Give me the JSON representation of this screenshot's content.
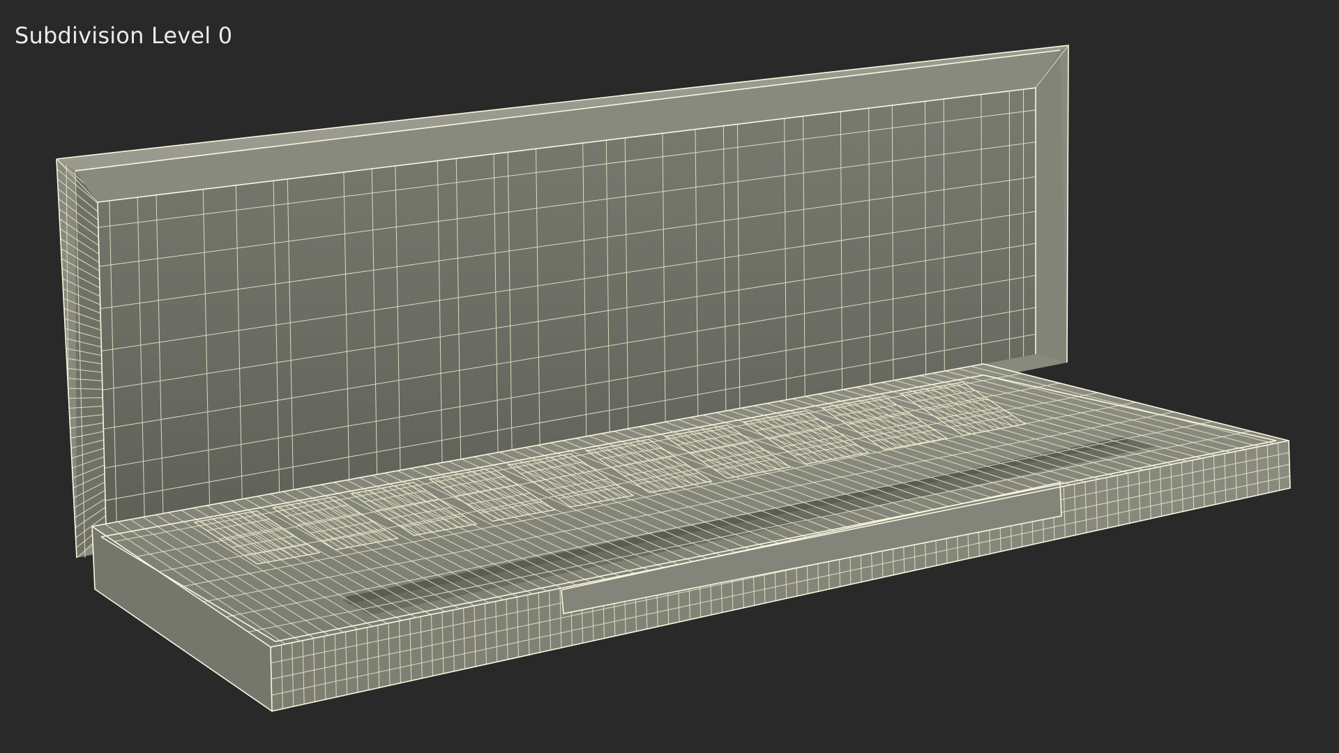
{
  "viewport": {
    "label": "Subdivision Level 0",
    "background_color": "#292929",
    "model_color": "#7a7a6e",
    "wire_color": "#f3efcf"
  }
}
